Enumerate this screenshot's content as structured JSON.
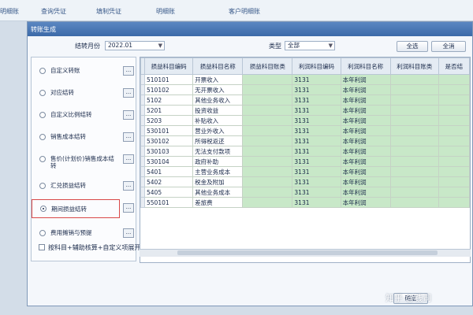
{
  "topnav": [
    "明细账",
    "查询凭证",
    "填制凭证",
    "明细账",
    "客户明细账"
  ],
  "dialog": {
    "title": "转账生成",
    "period_label": "结转月份",
    "period_value": "2022.01",
    "type_label": "类型",
    "type_value": "全部",
    "select_all_label": "全选",
    "clear_all_label": "全消"
  },
  "options": [
    {
      "label": "自定义转账",
      "checked": false
    },
    {
      "label": "对应结转",
      "checked": false
    },
    {
      "label": "自定义比例结转",
      "checked": false
    },
    {
      "label": "销售成本结转",
      "checked": false
    },
    {
      "label": "售价(计划价)销售成本结转",
      "checked": false
    },
    {
      "label": "汇兑损益结转",
      "checked": false
    },
    {
      "label": "期间损益结转",
      "checked": true
    },
    {
      "label": "费用摊销与预提",
      "checked": false
    }
  ],
  "options_button": "...",
  "bottom_check_label": "按科目+辅助核算+自定义项展开",
  "table": {
    "columns": [
      "",
      "损益科目编码",
      "损益科目名称",
      "损益科目账类",
      "利润科目编码",
      "利润科目名称",
      "利润科目账类",
      "是否结"
    ],
    "rows": [
      [
        "510101",
        "开票收入",
        "",
        "3131",
        "本年利润",
        ""
      ],
      [
        "510102",
        "无开票收入",
        "",
        "3131",
        "本年利润",
        ""
      ],
      [
        "5102",
        "其他业务收入",
        "",
        "3131",
        "本年利润",
        ""
      ],
      [
        "5201",
        "投资收益",
        "",
        "3131",
        "本年利润",
        ""
      ],
      [
        "5203",
        "补贴收入",
        "",
        "3131",
        "本年利润",
        ""
      ],
      [
        "530101",
        "营业外收入",
        "",
        "3131",
        "本年利润",
        ""
      ],
      [
        "530102",
        "所得税返还",
        "",
        "3131",
        "本年利润",
        ""
      ],
      [
        "530103",
        "无法支付款项",
        "",
        "3131",
        "本年利润",
        ""
      ],
      [
        "530104",
        "政府补助",
        "",
        "3131",
        "本年利润",
        ""
      ],
      [
        "5401",
        "主营业务成本",
        "",
        "3131",
        "本年利润",
        ""
      ],
      [
        "5402",
        "税金及附加",
        "",
        "3131",
        "本年利润",
        ""
      ],
      [
        "5405",
        "其他业务成本",
        "",
        "3131",
        "本年利润",
        ""
      ],
      [
        "550101",
        "差旅费",
        "",
        "3131",
        "本年利润",
        ""
      ]
    ]
  },
  "ok_label": "确定",
  "watermark": "知乎 @钱司",
  "colors": {
    "title_bar": "#3c6aa8",
    "grid_green": "#c8e8c8",
    "selected_border": "#d94848"
  }
}
